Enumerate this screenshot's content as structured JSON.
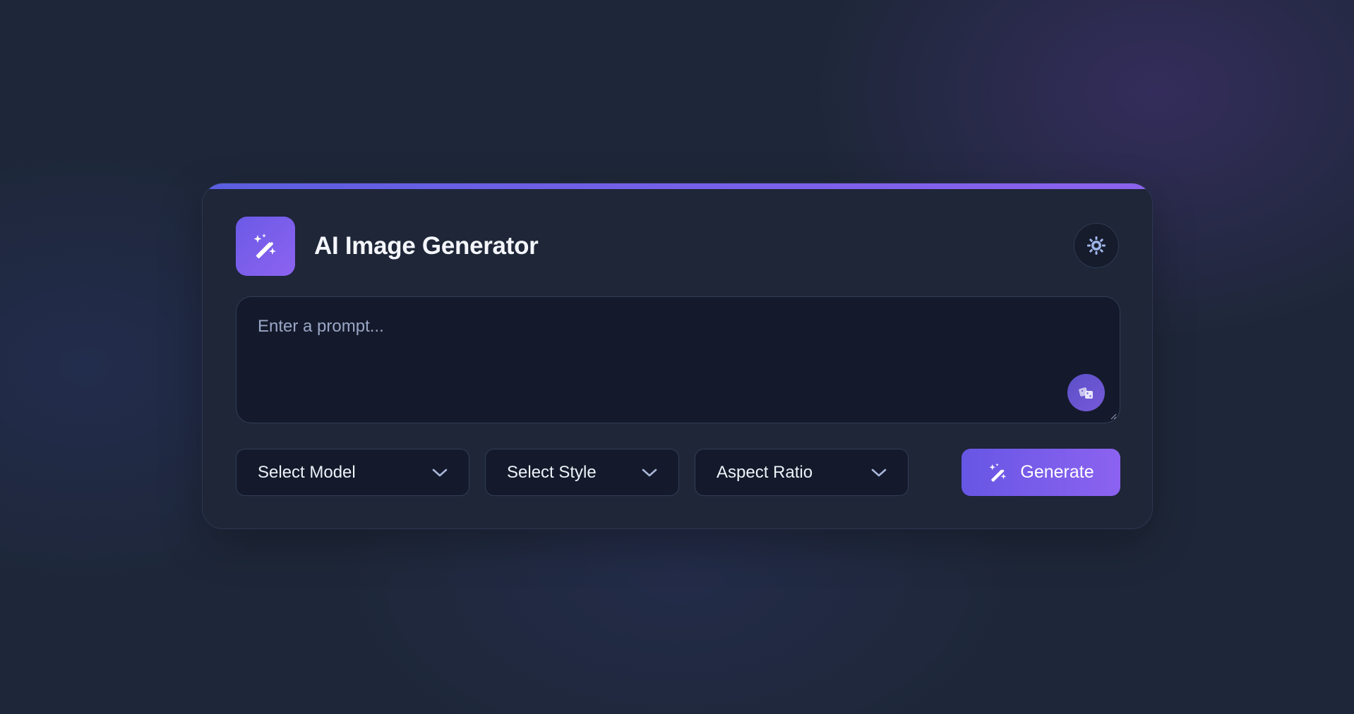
{
  "app": {
    "title": "AI Image Generator",
    "logo_icon": "magic-wand-icon",
    "accent_color": "#7a60ea"
  },
  "header": {
    "theme_toggle_icon": "sun-icon"
  },
  "prompt": {
    "value": "",
    "placeholder": "Enter a prompt...",
    "random_prompt_icon": "dice-icon"
  },
  "controls": {
    "model_select": {
      "label": "Select Model",
      "icon": "chevron-down-icon"
    },
    "style_select": {
      "label": "Select Style",
      "icon": "chevron-down-icon"
    },
    "ratio_select": {
      "label": "Aspect Ratio",
      "icon": "chevron-down-icon"
    },
    "generate_button": {
      "label": "Generate",
      "icon": "magic-wand-icon"
    }
  }
}
